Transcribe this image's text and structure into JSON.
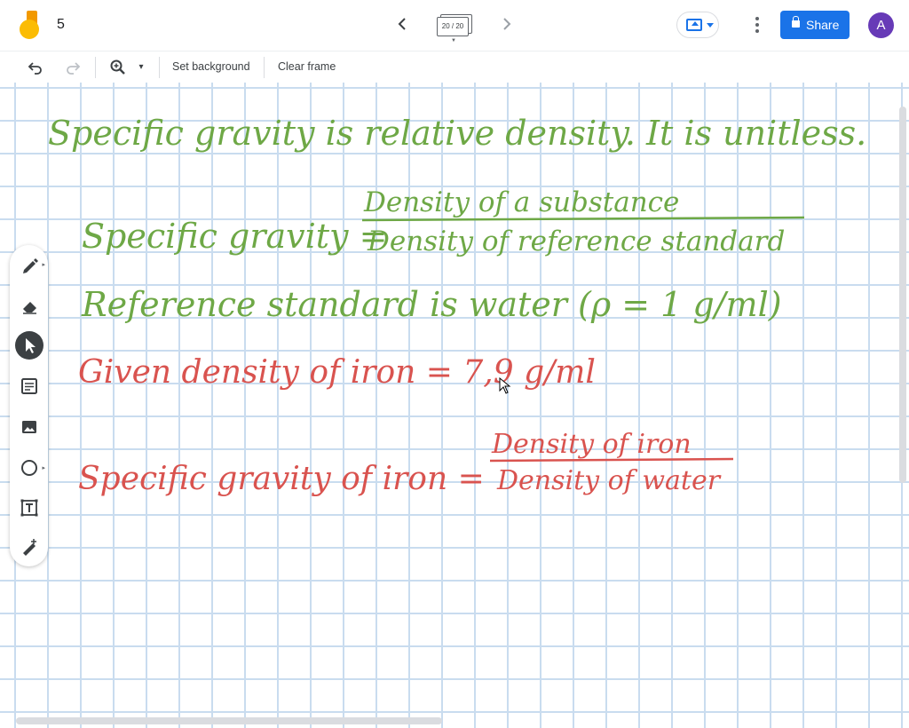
{
  "app": {
    "title": "5",
    "frame_counter": "20 / 20",
    "share_label": "Share",
    "avatar_initial": "A"
  },
  "toolbar": {
    "set_background": "Set background",
    "clear_frame": "Clear frame"
  },
  "icons": {
    "undo": "undo-icon",
    "redo": "redo-icon",
    "zoom": "zoom-icon",
    "pen": "pen-icon",
    "eraser": "eraser-icon",
    "select": "select-arrow-icon",
    "sticky_note": "sticky-note-icon",
    "image": "image-icon",
    "circle": "circle-icon",
    "text_box": "text-box-icon",
    "laser": "laser-icon"
  },
  "colors": {
    "accent": "#1a73e8",
    "avatar": "#673ab7",
    "green_ink": "#6ea846",
    "red_ink": "#d9534f",
    "grid": "#c9dcef"
  },
  "board": {
    "line1": "Specific gravity is relative density. It is unitless.",
    "sg_label": "Specific gravity =",
    "sg_numerator": "Density of a substance",
    "sg_denominator": "Density of reference standard",
    "line3": "Reference standard is water (ρ = 1 g/ml)",
    "line4": "Given density of iron = 7,9 g/ml",
    "sgi_label": "Specific gravity of iron =",
    "sgi_numerator": "Density of iron",
    "sgi_denominator": "Density of water"
  }
}
